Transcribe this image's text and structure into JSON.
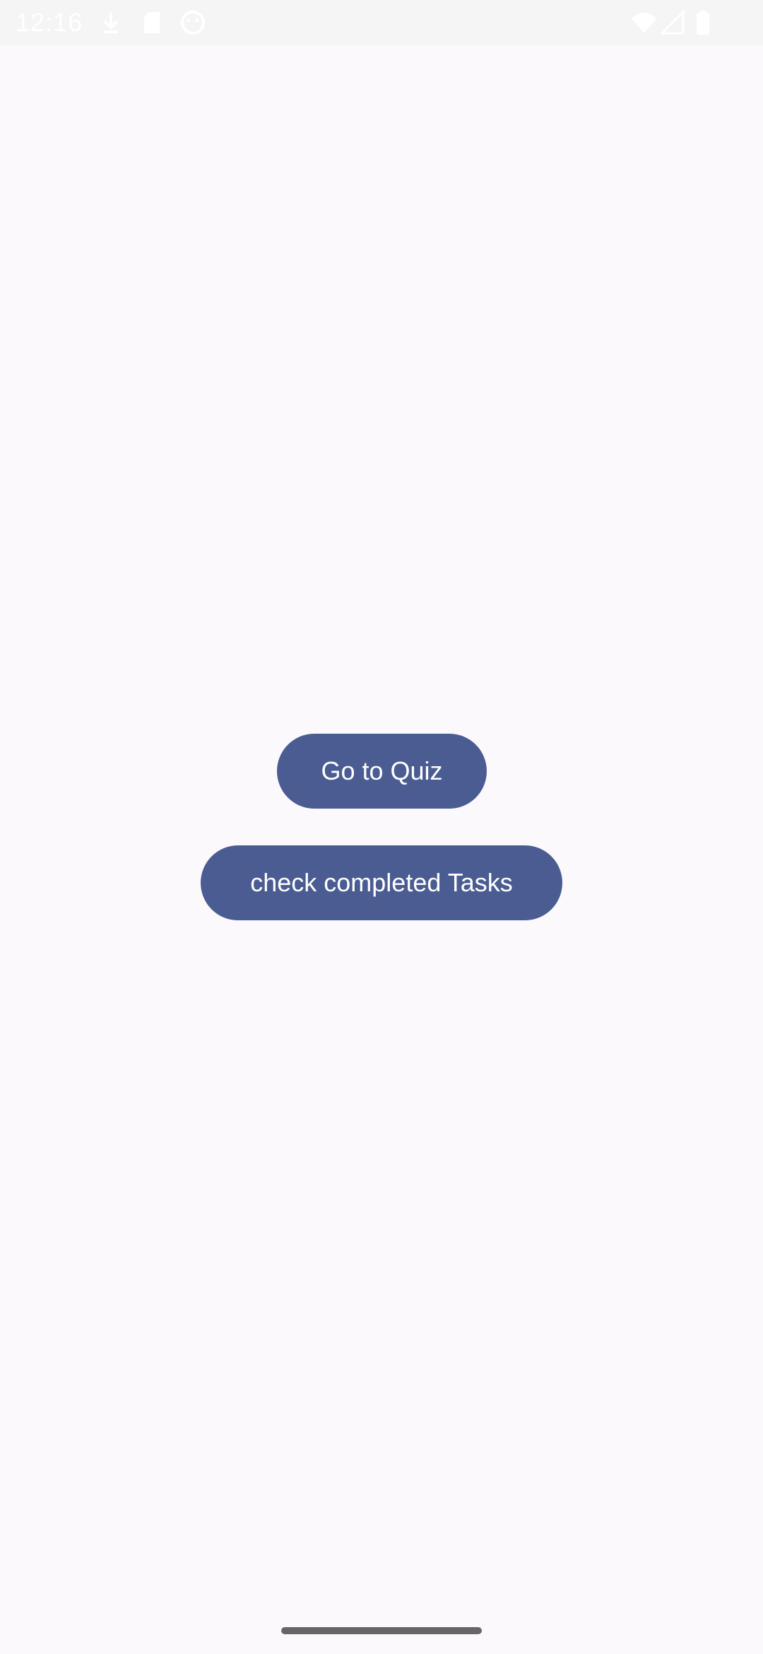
{
  "status_bar": {
    "time": "12:16",
    "icons": [
      "download-icon",
      "sd-card-icon",
      "face-icon",
      "wifi-icon",
      "signal-icon",
      "battery-icon"
    ]
  },
  "buttons": {
    "quiz_label": "Go to Quiz",
    "tasks_label": "check completed Tasks"
  },
  "colors": {
    "button_bg": "#4a5c92",
    "background": "#fcf9fc",
    "button_text": "#ffffff"
  }
}
